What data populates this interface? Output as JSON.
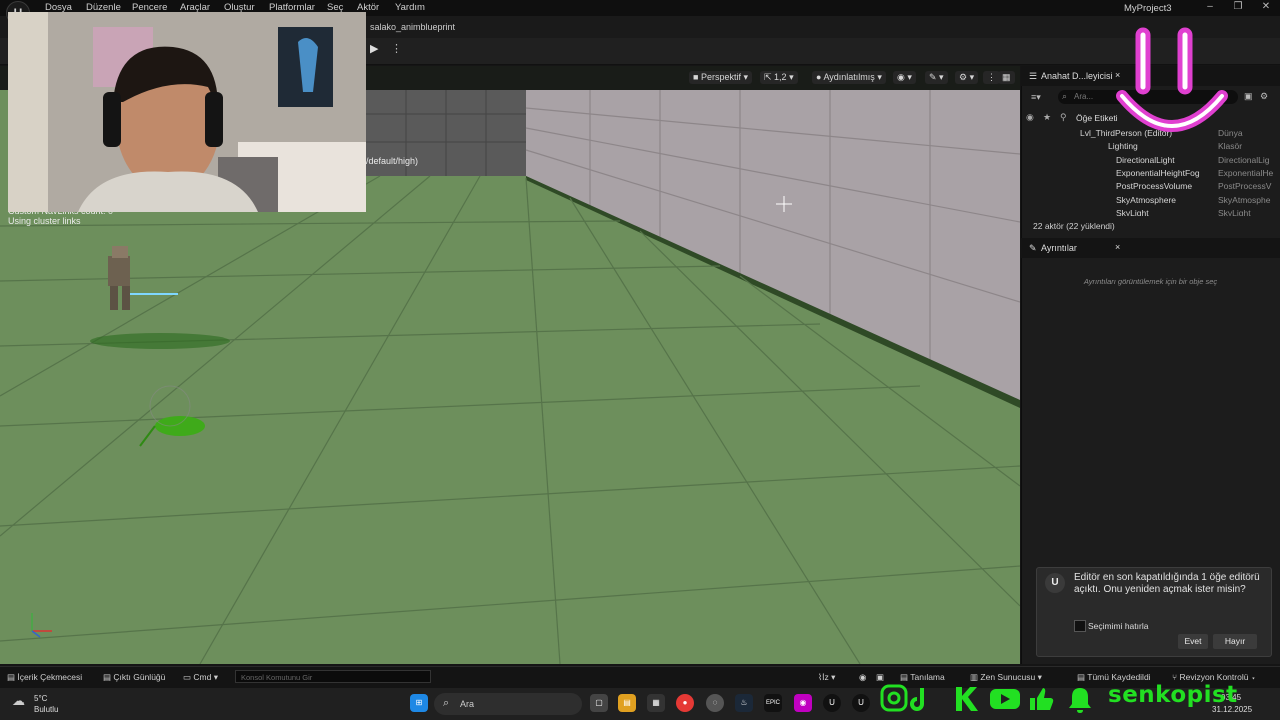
{
  "app": {
    "project_name": "MyProject3",
    "asset_tab": "salako_animblueprint",
    "logo_letter": "U"
  },
  "menu": [
    "Dosya",
    "Düzenle",
    "Pencere",
    "Araçlar",
    "Oluştur",
    "Platformlar",
    "Seç",
    "Aktör",
    "Yardım"
  ],
  "viewport": {
    "perspective_label": "Perspektif",
    "scale_label": "1,2",
    "lighting_label": "Aydınlatılmış",
    "res_text": "/default/high)",
    "debug_lines": [
      "Custom NavLinks count: 0",
      "Using cluster links"
    ]
  },
  "outliner": {
    "tab_title": "Anahat D...leyicisi",
    "search_placeholder": "Ara...",
    "col_label": "Öğe Etiketi",
    "rows": [
      {
        "name": "Lvl_ThirdPerson (Editör)",
        "type": "Dünya"
      },
      {
        "name": "Lighting",
        "type": "Klasör"
      },
      {
        "name": "DirectionalLight",
        "type": "DirectionalLig"
      },
      {
        "name": "ExponentialHeightFog",
        "type": "ExponentialHe"
      },
      {
        "name": "PostProcessVolume",
        "type": "PostProcessV"
      },
      {
        "name": "SkyAtmosphere",
        "type": "SkyAtmosphe"
      },
      {
        "name": "SkyLight",
        "type": "SkyLight"
      }
    ],
    "actor_count": "22 aktör (22 yüklendi)"
  },
  "details": {
    "tab_title": "Ayrıntılar",
    "empty_text": "Ayrıntıları görüntülemek için bir obje seç"
  },
  "notification": {
    "message": "Editör en son kapatıldığında 1 öğe editörü açıktı. Onu yeniden açmak ister misin?",
    "remember_label": "Seçimimi hatırla",
    "yes_label": "Evet",
    "no_label": "Hayır"
  },
  "statusbar": {
    "content_drawer": "İçerik Çekmecesi",
    "output_log": "Çıktı Günlüğü",
    "cmd": "Cmd",
    "console_placeholder": "Konsol Komutunu Gir",
    "trace": "İz",
    "diagnose": "Tanılama",
    "zen": "Zen Sunucusu",
    "save_all": "Tümü Kaydedildi",
    "revision": "Revizyon Kontrolü"
  },
  "taskbar": {
    "weather_temp": "5°C",
    "weather_desc": "Bulutlu",
    "search_label": "Ara",
    "time": "03:45",
    "date": "31.12.2025",
    "epic_label": "EPIC"
  },
  "overlay": {
    "social_name": "senkopist"
  },
  "colors": {
    "floor": "#6d8f5c",
    "wall": "#a9a2a6",
    "accent_pink": "#e040d0",
    "social_green": "#22e022"
  }
}
